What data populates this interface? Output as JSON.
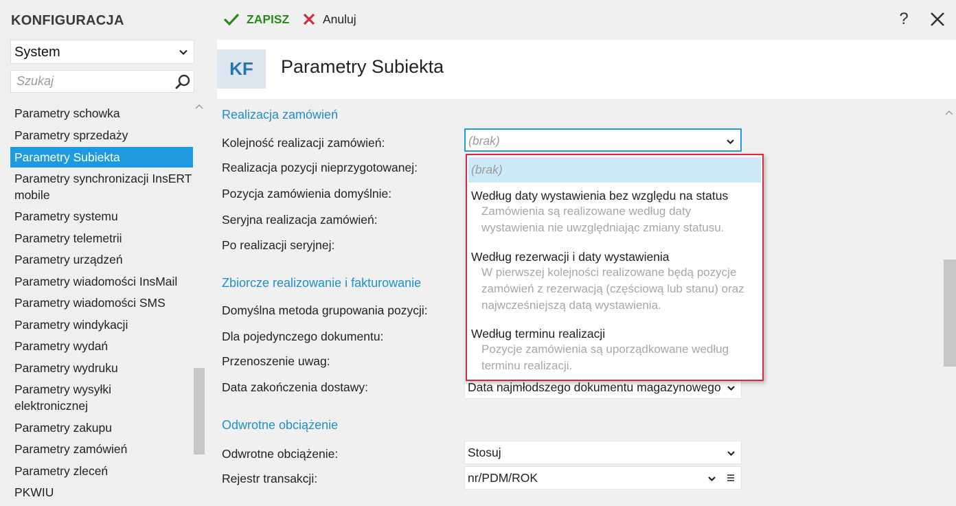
{
  "app": {
    "title": "KONFIGURACJA"
  },
  "sidebar": {
    "module": "System",
    "search_placeholder": "Szukaj",
    "items": [
      "Parametry schowka",
      "Parametry sprzedaży",
      "Parametry Subiekta",
      "Parametry synchronizacji InsERT mobile",
      "Parametry systemu",
      "Parametry telemetrii",
      "Parametry urządzeń",
      "Parametry wiadomości InsMail",
      "Parametry wiadomości SMS",
      "Parametry windykacji",
      "Parametry wydań",
      "Parametry wydruku",
      "Parametry wysyłki elektronicznej",
      "Parametry zakupu",
      "Parametry zamówień",
      "Parametry zleceń",
      "PKWIU"
    ],
    "active_item": "Parametry Subiekta"
  },
  "toolbar": {
    "save_label": "ZAPISZ",
    "cancel_label": "Anuluj",
    "help_label": "?"
  },
  "header": {
    "badge": "KF",
    "title": "Parametry Subiekta"
  },
  "sections": {
    "realizacja": {
      "title": "Realizacja zamówień",
      "fields": [
        "Kolejność realizacji zamówień:",
        "Realizacja pozycji nieprzygotowanej:",
        "Pozycja zamówienia domyślnie:",
        "Seryjna realizacja zamówień:",
        "Po realizacji seryjnej:"
      ],
      "kolejnosc_value": "(brak)"
    },
    "zbiorcze": {
      "title": "Zbiorcze realizowanie i fakturowanie",
      "fields": [
        "Domyślna metoda grupowania pozycji:",
        "Dla pojedynczego dokumentu:",
        "Przenoszenie uwag:",
        "Data zakończenia dostawy:"
      ],
      "data_zakonczenia_value": "Data najmłodszego dokumentu magazynowego"
    },
    "odwrotne": {
      "title": "Odwrotne obciążenie",
      "fields": [
        "Odwrotne obciążenie:",
        "Rejestr transakcji:"
      ],
      "odwrotne_value": "Stosuj",
      "rejestr_value": "nr/PDM/ROK"
    }
  },
  "dropdown": {
    "options": [
      {
        "title": "(brak)",
        "desc": []
      },
      {
        "title": "Według daty wystawienia bez względu na status",
        "desc": [
          "Zamówienia są realizowane według daty",
          "wystawienia nie uwzględniając zmiany statusu."
        ]
      },
      {
        "title": "Według rezerwacji i daty wystawienia",
        "desc": [
          "W pierwszej kolejności realizowane będą pozycje",
          "zamówień z rezerwacją (częściową lub stanu) oraz",
          "najwcześniejszą datą wystawienia."
        ]
      },
      {
        "title": "Według terminu realizacji",
        "desc": [
          "Pozycje zamówienia są uporządkowane według",
          "terminu realizacji."
        ]
      }
    ],
    "selected_index": 0
  },
  "colors": {
    "accent": "#1e9be0",
    "section": "#1f8fca",
    "save": "#2a8a1a",
    "cancel": "#d9283a",
    "dropdown_border": "#d9283a"
  }
}
